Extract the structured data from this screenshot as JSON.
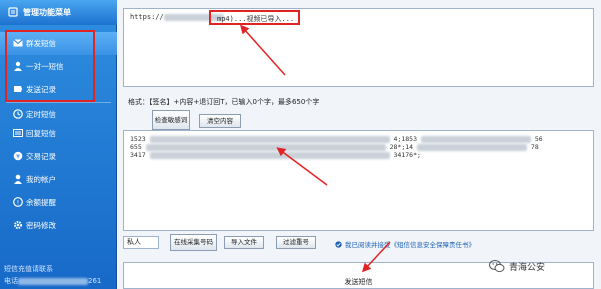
{
  "sidebar": {
    "header": "管理功能菜单",
    "items": [
      {
        "label": "群发短信",
        "icon": "send-sms-icon"
      },
      {
        "label": "一对一短信",
        "icon": "one-to-one-icon"
      },
      {
        "label": "发送记录",
        "icon": "record-icon"
      },
      {
        "label": "定时短信",
        "icon": "clock-icon"
      },
      {
        "label": "回复短信",
        "icon": "reply-icon"
      },
      {
        "label": "交易记录",
        "icon": "transaction-icon"
      },
      {
        "label": "我的帐户",
        "icon": "user-icon"
      },
      {
        "label": "余额提醒",
        "icon": "balance-icon"
      },
      {
        "label": "密码修改",
        "icon": "gear-icon"
      }
    ],
    "footer_line1": "短信充值请联系",
    "footer_line2_prefix": "电话",
    "footer_line2_suffix": "261"
  },
  "main": {
    "top_text_prefix": "https://",
    "top_text_highlight": "mp4)...视频已导入...",
    "format_label": "格式：【签名】+内容+退订回T，已输入0个字，最多650个字",
    "check_button": "检查敏感词",
    "clear_button": "清空内容",
    "numbers_rows": [
      {
        "left": "1523",
        "right": "4;1853",
        "right2": "56"
      },
      {
        "left": "655",
        "right": "28*;14",
        "right2": "78"
      },
      {
        "left": "3417",
        "right": "34176*;",
        "right2": ""
      }
    ],
    "sender_input": "私人",
    "online_collect_button": "在线采集号码",
    "import_button": "导入文件",
    "filter_button": "过滤重号",
    "agree_text": "我已阅读并接受《短信信息安全保障责任书》",
    "send_button": "发送短信"
  },
  "watermark": {
    "text": "青海公安"
  },
  "colors": {
    "sidebar": "#1f78d6",
    "highlight": "#e02424",
    "link": "#1a5fb4"
  }
}
